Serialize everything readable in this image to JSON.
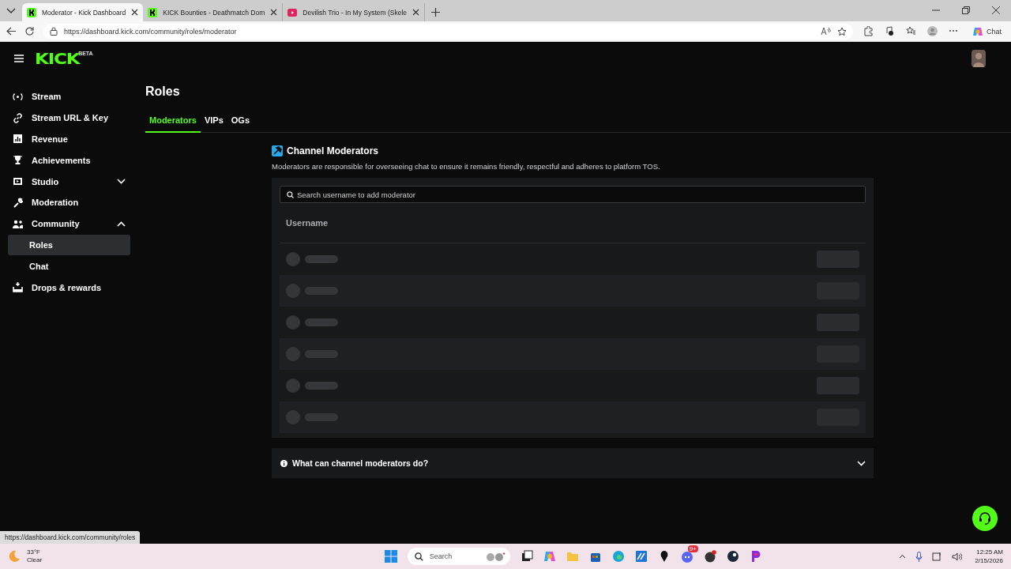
{
  "browser": {
    "tabs": [
      {
        "title": "Moderator - Kick Dashboard",
        "selected": true
      },
      {
        "title": "KICK Bounties - Deathmatch Dom",
        "selected": false
      },
      {
        "title": "Devilish Trio - In My System (Skele",
        "selected": false
      }
    ],
    "address": "https://dashboard.kick.com/community/roles/moderator",
    "chat_label": "Chat"
  },
  "header": {
    "logo": "KICK",
    "logo_badge": "BETA"
  },
  "sidebar": {
    "items": [
      {
        "label": "Stream",
        "selected": false
      },
      {
        "label": "Stream URL & Key",
        "selected": false
      },
      {
        "label": "Revenue",
        "selected": false
      },
      {
        "label": "Achievements",
        "selected": false
      },
      {
        "label": "Studio",
        "selected": false,
        "expanded": false
      },
      {
        "label": "Moderation",
        "selected": false
      },
      {
        "label": "Community",
        "selected": false,
        "expanded": true,
        "children": [
          {
            "label": "Roles",
            "selected": true
          },
          {
            "label": "Chat",
            "selected": false
          }
        ]
      },
      {
        "label": "Drops & rewards",
        "selected": false
      }
    ]
  },
  "page": {
    "title": "Roles",
    "tabs": [
      {
        "label": "Moderators",
        "selected": true
      },
      {
        "label": "VIPs",
        "selected": false
      },
      {
        "label": "OGs",
        "selected": false
      }
    ]
  },
  "section": {
    "title": "Channel Moderators",
    "description": "Moderators are responsible for overseeing chat to ensure it remains friendly, respectful and adheres to platform TOS.",
    "search": {
      "placeholder": "Search username to add moderator"
    },
    "table": {
      "columns": [
        "Username"
      ],
      "rows": [
        {
          "kind": "placeholder"
        },
        {
          "kind": "placeholder"
        },
        {
          "kind": "placeholder"
        },
        {
          "kind": "placeholder"
        },
        {
          "kind": "placeholder"
        },
        {
          "kind": "placeholder"
        }
      ]
    },
    "faq": {
      "question": "What can channel moderators do?",
      "expanded": false
    }
  },
  "status_url": "https://dashboard.kick.com/community/roles",
  "taskbar": {
    "weather": {
      "temp": "33°F",
      "condition": "Clear"
    },
    "search_placeholder": "Search",
    "discord_badge": "9+",
    "time": "12:25 AM",
    "date": "2/15/2026"
  }
}
